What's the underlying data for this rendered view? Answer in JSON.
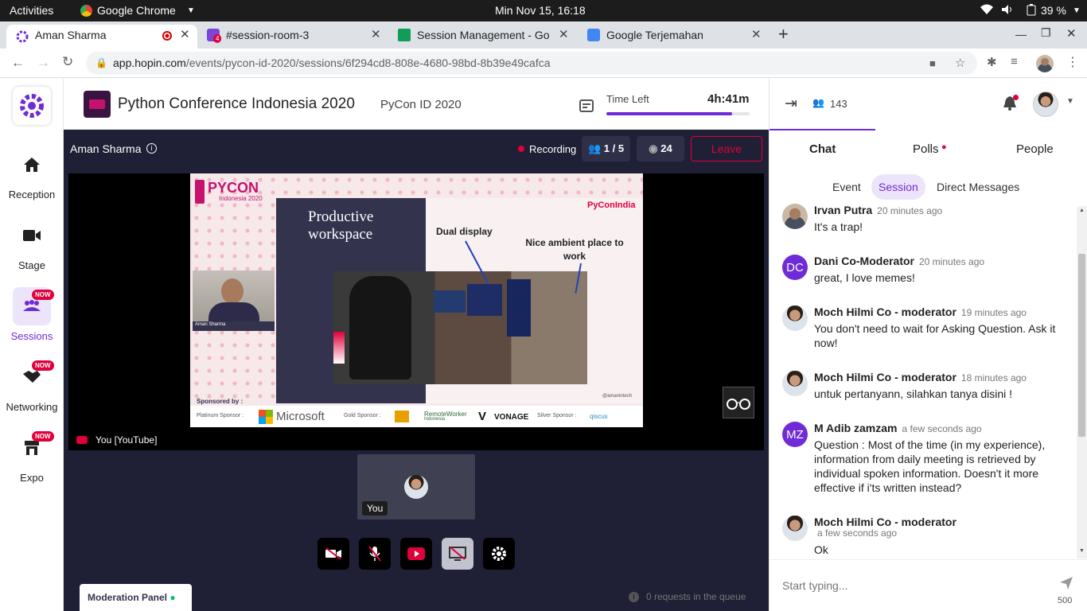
{
  "system": {
    "activities": "Activities",
    "app": "Google Chrome",
    "datetime": "Min Nov 15, 16:18",
    "battery": "39 %"
  },
  "tabs": [
    {
      "title": "Aman Sharma"
    },
    {
      "title": "#session-room-3",
      "badge": "4"
    },
    {
      "title": "Session Management - Go"
    },
    {
      "title": "Google Terjemahan"
    }
  ],
  "address": {
    "host": "app.hopin.com",
    "path": "/events/pycon-id-2020/sessions/6f294cd8-808e-4680-98bd-8b39e49cafca"
  },
  "nav": {
    "items": [
      {
        "label": "Reception"
      },
      {
        "label": "Stage"
      },
      {
        "label": "Sessions",
        "badge": "NOW"
      },
      {
        "label": "Networking",
        "badge": "NOW"
      },
      {
        "label": "Expo",
        "badge": "NOW"
      }
    ]
  },
  "event": {
    "title": "Python Conference Indonesia 2020",
    "org": "PyCon ID 2020",
    "time_left_label": "Time Left",
    "time_left": "4h:41m",
    "time_progress": 0.88
  },
  "stage": {
    "speaker": "Aman Sharma",
    "recording": "Recording",
    "participants": "1 / 5",
    "viewers": "24",
    "leave": "Leave",
    "stream_label": "You [YouTube]",
    "self_label": "You",
    "moderation": "Moderation Panel",
    "queue": "0 requests in the queue"
  },
  "slide": {
    "logo": "PYCON",
    "logo_sub": "Indonesia 2020",
    "title": "Productive workspace",
    "label1": "Dual display",
    "label2": "Nice ambient place to work",
    "brand": "PyConIndia",
    "cam_name": "Aman Sharma",
    "handle": "@amanintech",
    "sponsored": "Sponsored by :",
    "platinum": "Platinum Sponsor :",
    "microsoft": "Microsoft",
    "gold": "Gold Sponsor :",
    "remote": "RemoteWorker",
    "remote_sub": "Indonesia",
    "vonage": "VONAGE",
    "silver": "Silver Sponsor :",
    "qiscus": "qiscus"
  },
  "panel": {
    "online": "143",
    "tabs": [
      "Chat",
      "Polls",
      "People"
    ],
    "subtabs": [
      "Event",
      "Session",
      "Direct Messages"
    ],
    "input_placeholder": "Start typing...",
    "char_count": "500"
  },
  "messages": [
    {
      "name": "Irvan Putra",
      "time": "20 minutes ago",
      "text": "It's a trap!"
    },
    {
      "name": "Dani Co-Moderator",
      "initials": "DC",
      "time": "20 minutes ago",
      "text": "great, I love memes!"
    },
    {
      "name": "Moch Hilmi Co - moderator",
      "time": "19 minutes ago",
      "text": "You don't need to wait for Asking Question. Ask it now!"
    },
    {
      "name": "Moch Hilmi Co - moderator",
      "time": "18 minutes ago",
      "text": "untuk pertanyann, silahkan tanya disini !"
    },
    {
      "name": "M Adib zamzam",
      "initials": "MZ",
      "time": "a few seconds ago",
      "text": "Question : Most of the time (in my experience), information from daily meeting is retrieved by individual spoken information. Doesn't it more effective if i'ts written instead?"
    },
    {
      "name": "Moch Hilmi Co - moderator",
      "time": "a few seconds ago",
      "text": "Ok"
    }
  ]
}
